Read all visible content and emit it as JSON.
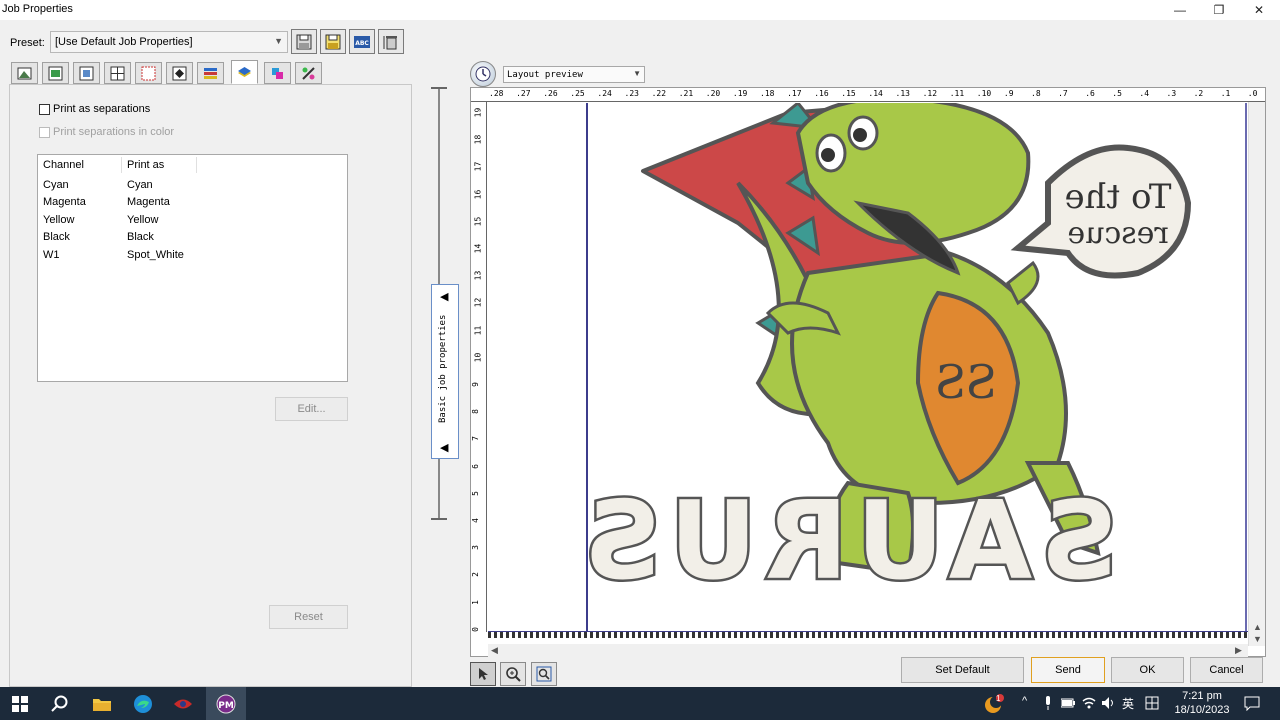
{
  "window": {
    "title": "Job Properties",
    "minimize_glyph": "—",
    "restore_glyph": "❐",
    "close_glyph": "✕"
  },
  "preset": {
    "label": "Preset:",
    "value": "[Use Default Job Properties]"
  },
  "toolbar_icons": [
    "save-icon",
    "save-as-icon",
    "rename-abc-icon",
    "delete-preset-icon"
  ],
  "toolbar_abc": "ABC",
  "tab_icons": [
    "media-icon",
    "layout-icon",
    "scaling-icon",
    "tiling-icon",
    "grid-icon",
    "color-management-icon",
    "ink-icon",
    "separations-icon",
    "spot-color-icon",
    "color-adjust-icon"
  ],
  "separations": {
    "print_as_separations": "Print as separations",
    "print_separations_in_color": "Print separations in color",
    "columns": {
      "channel": "Channel",
      "print_as": "Print as"
    },
    "rows": [
      {
        "channel": "Cyan",
        "print_as": "Cyan"
      },
      {
        "channel": "Magenta",
        "print_as": "Magenta"
      },
      {
        "channel": "Yellow",
        "print_as": "Yellow"
      },
      {
        "channel": "Black",
        "print_as": "Black"
      },
      {
        "channel": "W1",
        "print_as": "Spot_White"
      }
    ],
    "edit_label": "Edit...",
    "reset_label": "Reset"
  },
  "splitter": {
    "label": "Basic job properties",
    "arrow_glyph": "◀"
  },
  "preview": {
    "mode": "Layout preview",
    "hruler": [
      ".28",
      ".27",
      ".26",
      ".25",
      ".24",
      ".23",
      ".22",
      ".21",
      ".20",
      ".19",
      ".18",
      ".17",
      ".16",
      ".15",
      ".14",
      ".13",
      ".12",
      ".11",
      ".10",
      ".9",
      ".8",
      ".7",
      ".6",
      ".5",
      ".4",
      ".3",
      ".2",
      ".1",
      ".0"
    ],
    "vruler": [
      "19",
      "18",
      "17",
      "16",
      "15",
      "14",
      "13",
      "12",
      "11",
      "10",
      "9",
      "8",
      "7",
      "6",
      "5",
      "4",
      "3",
      "2",
      "1",
      "0"
    ],
    "artwork": {
      "speech_line1": "To the",
      "speech_line2": "rescue",
      "logo": "SS",
      "word": "SAURUS"
    }
  },
  "actions": {
    "set_default": "Set Default",
    "send": "Send",
    "ok": "OK",
    "cancel": "Cancel"
  },
  "taskbar": {
    "ime": "英",
    "time": "7:21 pm",
    "date": "18/10/2023",
    "badge": "1"
  }
}
